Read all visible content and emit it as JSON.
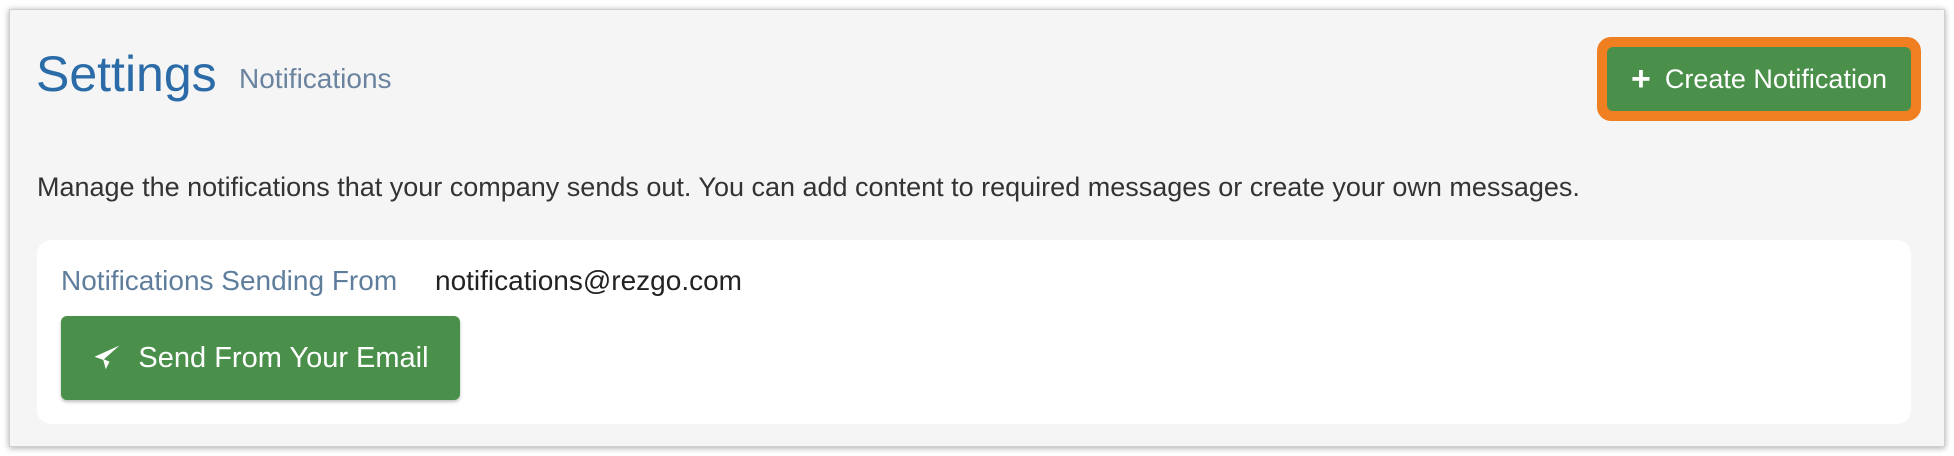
{
  "header": {
    "title": "Settings",
    "subtitle": "Notifications",
    "create_button_label": "Create Notification"
  },
  "description": "Manage the notifications that your company sends out. You can add content to required messages or create your own messages.",
  "sending_from": {
    "label": "Notifications Sending From",
    "email": "notifications@rezgo.com",
    "send_button_label": "Send From Your Email"
  },
  "icons": {
    "create": "plus-icon",
    "send": "paper-plane-icon"
  },
  "colors": {
    "title": "#2b6ca8",
    "button_green": "#4a8f4a",
    "highlight_orange": "#f07f22",
    "muted_label": "#5f7e9c"
  }
}
